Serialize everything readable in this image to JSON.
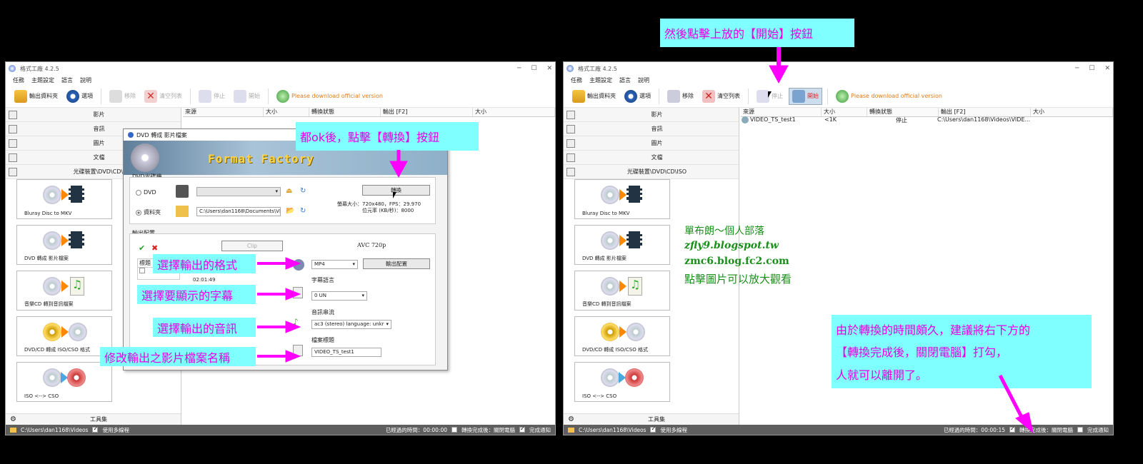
{
  "left": {
    "title": "格式工廠 4.2.5",
    "menu": [
      "任務",
      "主題設定",
      "語言",
      "說明"
    ],
    "toolbar": {
      "output_folder": "輸出資料夾",
      "options": "選項",
      "remove": "移除",
      "clear": "清空列表",
      "stop": "停止",
      "start": "開始",
      "download": "Please download official version"
    },
    "categories": [
      "影片",
      "音訊",
      "圖片",
      "文檔",
      "光碟裝置\\DVD\\CD\\I"
    ],
    "tiles": [
      "Bluray Disc to MKV",
      "DVD 轉成 影片檔案",
      "音樂CD 轉到音訊檔案",
      "DVD/CD 轉成 ISO/CSO 格式",
      "ISO <--> CSO"
    ],
    "toolbox": "工具集",
    "list_headers": [
      "來源",
      "大小",
      "轉換狀態",
      "輸出 [F2]",
      "大小"
    ],
    "status": {
      "path": "C:\\Users\\dan1168\\Videos",
      "multithread": "使用多線程",
      "elapsed": "已經過的時間：00:00:00",
      "shutdown": "轉換完成後：關閉電腦",
      "notify": "完成通知"
    }
  },
  "dialog": {
    "title": "DVD 轉成 影片檔案",
    "brand": "Format Factory",
    "dvd_group": "DVD光碟機",
    "opt_dvd": "DVD",
    "opt_folder": "資料夾",
    "folder_path": "C:\\Users\\dan1168\\Documents\\VIDEO",
    "convert": "轉換",
    "info1": "螢幕大小：720x480，FPS：29.970",
    "info2": "位元率 (KB/秒)：8000",
    "output_group": "輸出配置",
    "clip": "Clip",
    "codec": "AVC 720p",
    "format": "MP4",
    "output_config": "輸出配置",
    "subtitle_label": "字幕語言",
    "subtitle": "0 UN",
    "audio_label": "音訊串流",
    "audio": "ac3 (stereo) language: unkr",
    "filename_label": "檔案標題",
    "filename": "VIDEO_TS_test1",
    "col": "標題",
    "time": "02:01:49"
  },
  "right": {
    "title": "格式工廠 4.2.5",
    "job": {
      "source": "VIDEO_TS_test1",
      "size": "<1K",
      "state": "停止",
      "output": "C:\\Users\\dan1168\\Videos\\VIDE..."
    },
    "categories": [
      "影片",
      "音訊",
      "圖片",
      "文檔",
      "光碟裝置\\DVD\\CD\\ISO"
    ],
    "status": {
      "elapsed": "已經過的時間：00:00:15"
    }
  },
  "callouts": {
    "c1": "都ok後，點擊【轉換】按鈕",
    "c2": "選擇輸出的格式",
    "c3": "選擇要顯示的字幕",
    "c4": "選擇輸出的音訊",
    "c5": "修改輸出之影片檔案名稱",
    "c6": "然後點擊上放的【開始】按鈕",
    "c7a": "由於轉換的時間頗久，建議將右下方的",
    "c7b": "【轉換完成後，關閉電腦】打勾，",
    "c7c": "人就可以離開了。"
  },
  "blog": {
    "l1": "單布朗～個人部落",
    "l2": "zfly9.blogspot.tw",
    "l3": "zmc6.blog.fc2.com",
    "l4": "點擊圖片可以放大觀看"
  },
  "colors": {
    "callout_bg": "#7fffff",
    "callout_text": "#e600e6",
    "arrow": "#ff00ff",
    "status_bg": "#5f5f5f",
    "blog_green": "#1a8f1a"
  }
}
